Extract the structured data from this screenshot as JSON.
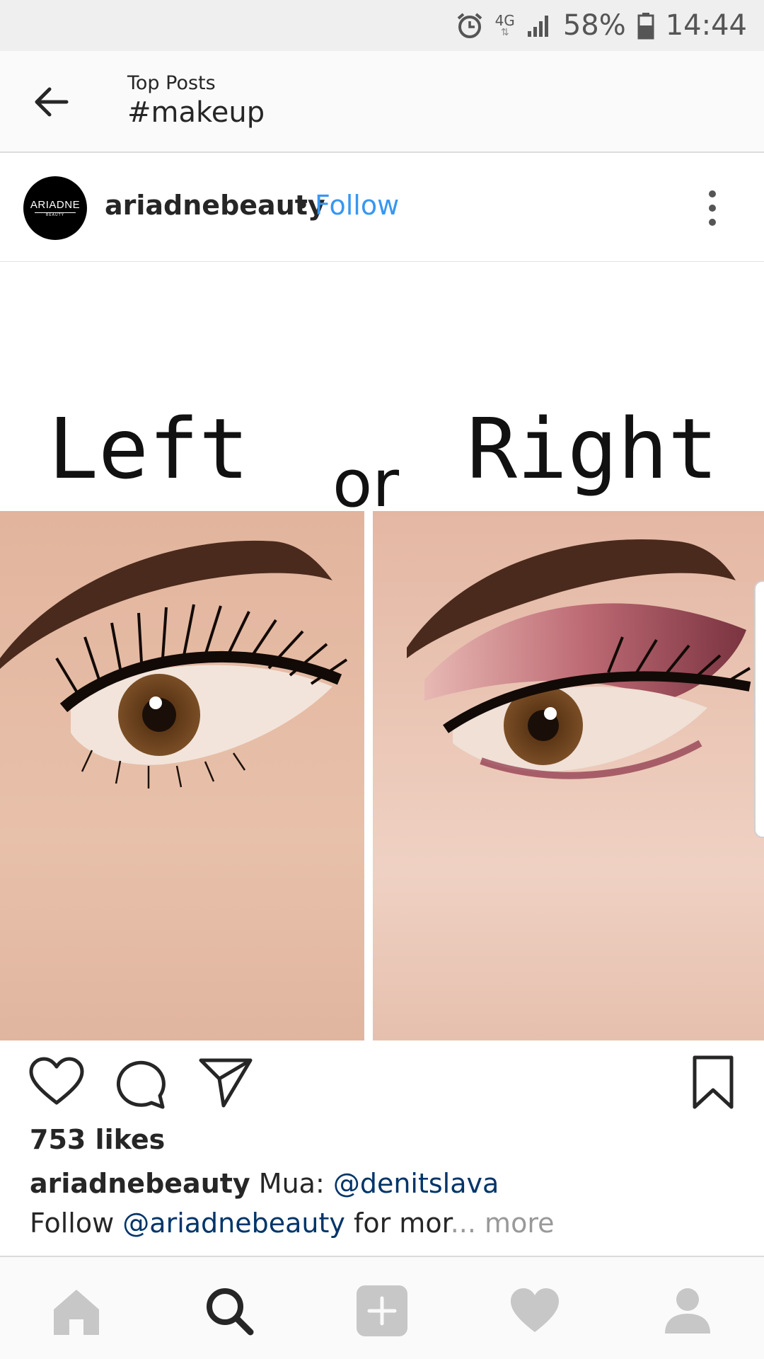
{
  "status_bar": {
    "network": "4G",
    "battery": "58%",
    "time": "14:44",
    "icons": [
      "alarm-icon",
      "network-4g-icon",
      "signal-icon",
      "battery-icon"
    ]
  },
  "header": {
    "subtitle": "Top Posts",
    "title": "#makeup",
    "back_icon": "arrow-left-icon"
  },
  "post": {
    "username": "ariadnebeauty",
    "separator": "•",
    "follow_label": "Follow",
    "avatar_text": "ARIADNE",
    "avatar_subtext": "BEAUTY",
    "image_text": {
      "left": "Left",
      "middle": "or",
      "right": "Right"
    },
    "likes": "753 likes",
    "caption_user": "ariadnebeauty",
    "caption_text": "Mua: ",
    "caption_mention": "@denitslava",
    "caption_line2_start": "Follow ",
    "caption_line2_mention": "@ariadnebeauty",
    "caption_line2_end": " for mor",
    "caption_ellipsis": "...",
    "more_label": "more"
  },
  "actions": [
    "heart-icon",
    "comment-icon",
    "share-icon",
    "bookmark-icon"
  ],
  "bottom_nav": [
    "home-icon",
    "search-icon",
    "add-post-icon",
    "activity-heart-icon",
    "profile-icon"
  ],
  "colors": {
    "link": "#3897f0",
    "mention": "#003569",
    "muted": "#999999",
    "nav_inactive": "#c7c7c7",
    "nav_active": "#262626"
  }
}
